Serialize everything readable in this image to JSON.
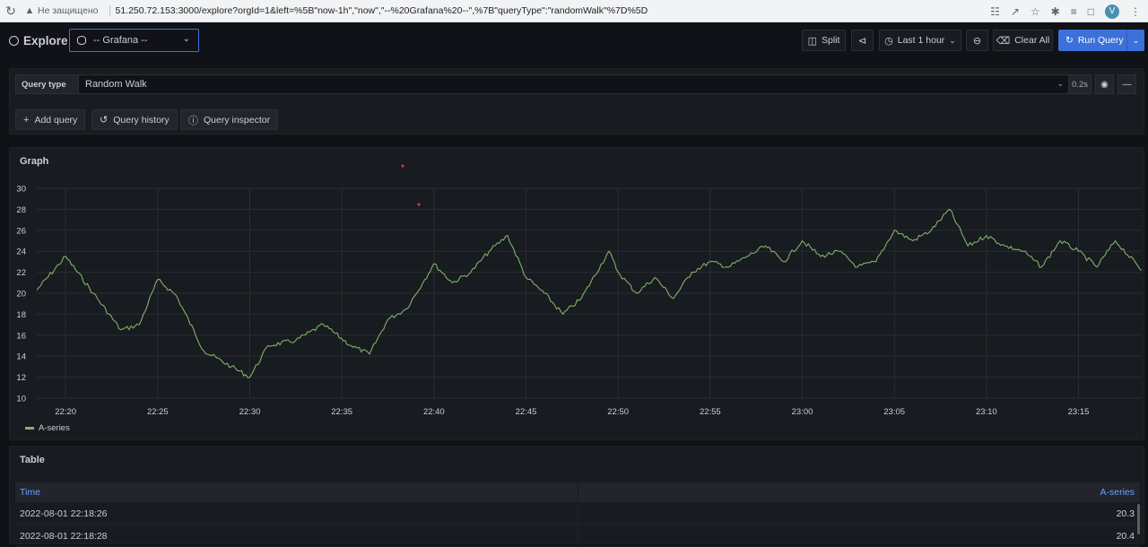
{
  "browser": {
    "insecure_label": "Не защищено",
    "url": "51.250.72.153:3000/explore?orgId=1&left=%5B\"now-1h\",\"now\",\"--%20Grafana%20--\",%7B\"queryType\":\"randomWalk\"%7D%5D",
    "avatar_letter": "V"
  },
  "toolbar": {
    "title": "Explore",
    "datasource": "-- Grafana --",
    "split_label": "Split",
    "time_range": "Last 1 hour",
    "clear_label": "Clear All",
    "run_label": "Run Query"
  },
  "query": {
    "type_label": "Query type",
    "type_value": "Random Walk",
    "time": "0.2s",
    "add_label": "Add query",
    "history_label": "Query history",
    "inspector_label": "Query inspector"
  },
  "graph": {
    "title": "Graph",
    "legend": "A-series",
    "color": "#7eb26d"
  },
  "table": {
    "title": "Table",
    "columns": [
      "Time",
      "A-series"
    ],
    "rows": [
      [
        "2022-08-01 22:18:26",
        "20.3"
      ],
      [
        "2022-08-01 22:18:28",
        "20.4"
      ]
    ]
  },
  "chart_data": {
    "type": "line",
    "title": "Graph",
    "xlabel": "",
    "ylabel": "",
    "ylim": [
      10,
      30
    ],
    "xlim": [
      "22:18:26",
      "23:18:26"
    ],
    "y_ticks": [
      10,
      12,
      14,
      16,
      18,
      20,
      22,
      24,
      26,
      28,
      30
    ],
    "x_ticks": [
      "22:20",
      "22:25",
      "22:30",
      "22:35",
      "22:40",
      "22:45",
      "22:50",
      "22:55",
      "23:00",
      "23:05",
      "23:10",
      "23:15"
    ],
    "grid": true,
    "legend_position": "bottom-left",
    "series": [
      {
        "name": "A-series",
        "x": [
          "22:18:26",
          "22:20:00",
          "22:21:30",
          "22:23:00",
          "22:24:00",
          "22:25:00",
          "22:26:00",
          "22:27:30",
          "22:29:00",
          "22:30:00",
          "22:31:00",
          "22:32:30",
          "22:34:00",
          "22:35:30",
          "22:36:30",
          "22:37:30",
          "22:38:30",
          "22:39:30",
          "22:40:00",
          "22:41:00",
          "22:42:00",
          "22:43:00",
          "22:44:00",
          "22:45:00",
          "22:46:00",
          "22:47:00",
          "22:48:00",
          "22:49:30",
          "22:50:00",
          "22:51:00",
          "22:52:00",
          "22:53:00",
          "22:54:00",
          "22:55:00",
          "22:56:00",
          "22:57:00",
          "22:58:00",
          "22:59:00",
          "23:00:00",
          "23:01:00",
          "23:02:00",
          "23:03:00",
          "23:04:00",
          "23:05:00",
          "23:06:00",
          "23:07:00",
          "23:08:00",
          "23:09:00",
          "23:10:00",
          "23:11:00",
          "23:12:00",
          "23:13:00",
          "23:14:00",
          "23:15:00",
          "23:16:00",
          "23:17:00",
          "23:18:26"
        ],
        "y": [
          20.3,
          23.5,
          20.0,
          16.5,
          17.0,
          21.3,
          19.8,
          14.5,
          13.0,
          12.0,
          15.0,
          15.5,
          17.0,
          15.0,
          14.2,
          17.5,
          18.5,
          21.3,
          22.8,
          21.0,
          22.0,
          24.0,
          25.5,
          21.5,
          20.0,
          18.0,
          19.5,
          24.0,
          22.0,
          20.0,
          21.5,
          19.5,
          22.0,
          23.0,
          22.5,
          23.5,
          24.5,
          23.0,
          25.0,
          23.5,
          24.0,
          22.5,
          23.0,
          26.0,
          25.0,
          26.0,
          28.0,
          24.5,
          25.5,
          24.5,
          24.0,
          22.5,
          25.0,
          24.0,
          22.5,
          25.0,
          22.2
        ]
      }
    ]
  }
}
